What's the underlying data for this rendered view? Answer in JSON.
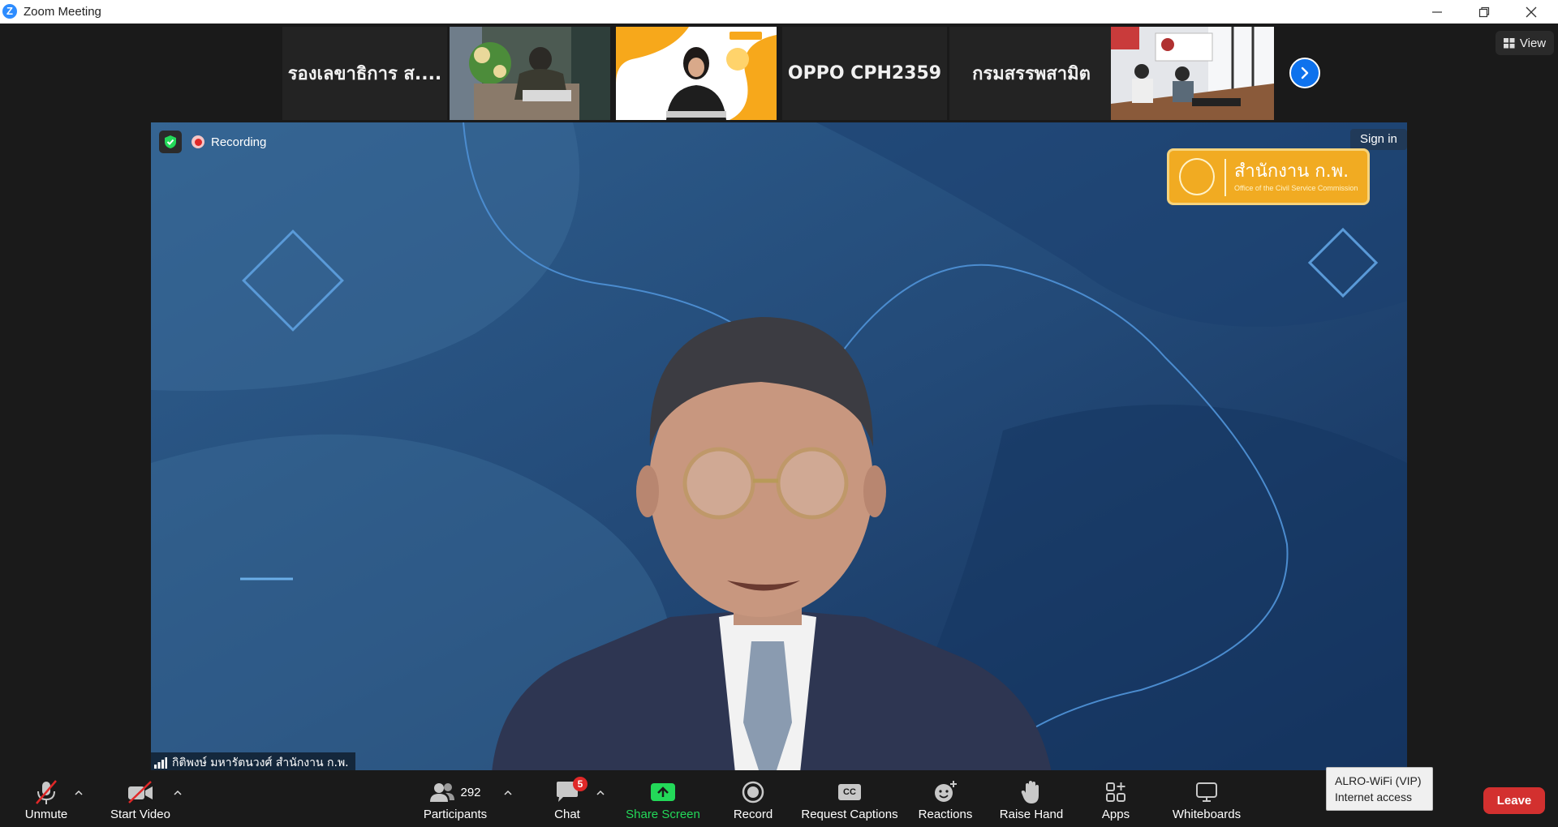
{
  "window": {
    "title": "Zoom Meeting",
    "logo_letter": "Z"
  },
  "strip": {
    "tiles": [
      {
        "name": "รองเลขาธิการ ส....",
        "kind": "name"
      },
      {
        "kind": "video",
        "scene": "office-desk"
      },
      {
        "kind": "video",
        "scene": "presenter-yellow-bg"
      },
      {
        "name": "OPPO CPH2359",
        "kind": "name"
      },
      {
        "name": "กรมสรรพสามิต",
        "kind": "name"
      },
      {
        "kind": "video",
        "scene": "meeting-room"
      }
    ],
    "next_icon": "chevron-right-icon"
  },
  "view_button": {
    "label": "View",
    "icon": "grid-icon"
  },
  "video": {
    "recording_label": "Recording",
    "signin_label": "Sign in",
    "logo_text": "สำนักงาน ก.พ.",
    "logo_subtext": "Office of the Civil Service Commission",
    "speaker_name": "กิติพงษ์ มหารัตนวงศ์ สำนักงาน ก.พ."
  },
  "toolbar": {
    "unmute": "Unmute",
    "start_video": "Start Video",
    "participants": "Participants",
    "participants_count": "292",
    "chat": "Chat",
    "chat_badge": "5",
    "share_screen": "Share Screen",
    "record": "Record",
    "request_captions": "Request Captions",
    "captions_icon_text": "CC",
    "reactions": "Reactions",
    "raise_hand": "Raise Hand",
    "apps": "Apps",
    "whiteboards": "Whiteboards",
    "leave": "Leave"
  },
  "wifi_tooltip": {
    "network": "ALRO-WiFi (VIP)",
    "status": "Internet access"
  },
  "colors": {
    "accent_blue": "#0e72ed",
    "share_green": "#23d959",
    "leave_red": "#d3302f",
    "video_bg": "#244a76",
    "logo_orange": "#f1ab22"
  }
}
